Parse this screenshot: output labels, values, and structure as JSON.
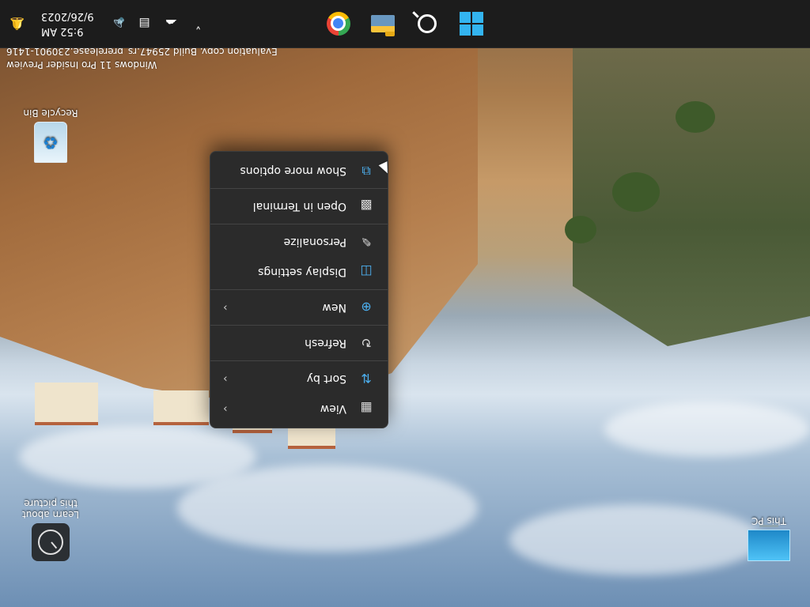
{
  "desktop": {
    "icons": [
      {
        "label": "This PC",
        "icon": "this-pc-icon"
      },
      {
        "label": "Learn about this picture",
        "icon": "learn-about-picture-icon"
      },
      {
        "label": "Recycle Bin",
        "icon": "recycle-bin-icon"
      }
    ],
    "watermark": {
      "line1": "Windows 11 Pro Insider Preview",
      "line2": "Evaluation copy. Build 25947.rs_prerelease.230901-1416"
    }
  },
  "context_menu": {
    "items": [
      {
        "label": "View",
        "icon": "view-grid-icon",
        "chevron": "›"
      },
      {
        "label": "Sort by",
        "icon": "sort-arrows-icon",
        "chevron": "›"
      },
      {
        "label": "Refresh",
        "icon": "refresh-icon"
      },
      {
        "label": "New",
        "icon": "new-plus-icon",
        "chevron": "›"
      },
      {
        "label": "Display settings",
        "icon": "display-settings-icon"
      },
      {
        "label": "Personalize",
        "icon": "personalize-brush-icon"
      },
      {
        "label": "Open in Terminal",
        "icon": "terminal-icon"
      },
      {
        "label": "Show more options",
        "icon": "show-more-options-icon"
      }
    ]
  },
  "taskbar": {
    "apps": [
      {
        "name": "Start",
        "icon": "windows-start-icon"
      },
      {
        "name": "Search",
        "icon": "search-icon"
      },
      {
        "name": "File Explorer",
        "icon": "file-explorer-icon"
      },
      {
        "name": "Google Chrome",
        "icon": "chrome-icon"
      }
    ],
    "tray": {
      "chevron": "˅",
      "clock_time": "9:52 AM",
      "clock_date": "9/26/2023"
    }
  },
  "colors": {
    "taskbar_bg": "#1c1c1c",
    "menu_bg": "#2b2b2b",
    "accent": "#33b4f0"
  }
}
